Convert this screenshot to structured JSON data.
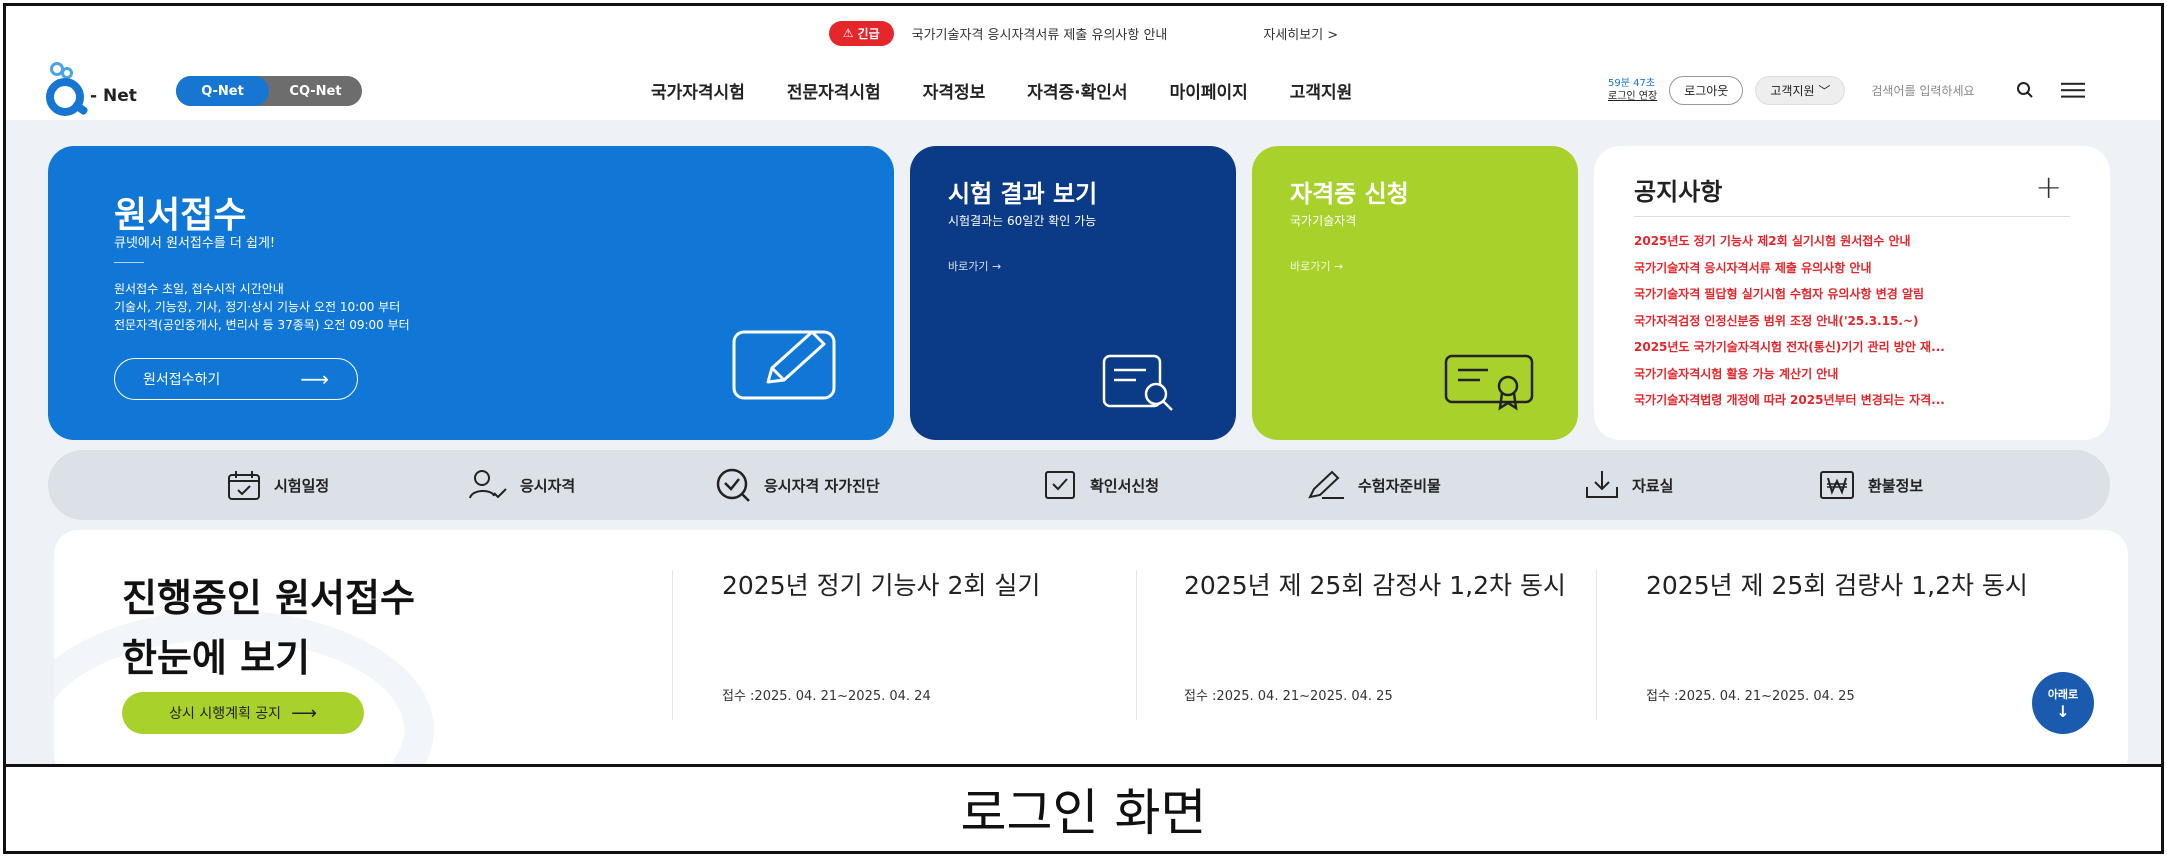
{
  "notice": {
    "badge": "긴급",
    "text": "국가기술자격 응시자격서류 제출 유의사항 안내",
    "more": "자세히보기  >"
  },
  "header": {
    "logo_text": "- Net",
    "toggle": [
      "Q-Net",
      "CQ-Net"
    ],
    "nav": [
      "국가자격시험",
      "전문자격시험",
      "자격정보",
      "자격증·확인서",
      "마이페이지",
      "고객지원"
    ],
    "timer": "59분 47초",
    "extend": "로그인 연장",
    "logout": "로그아웃",
    "support": "고객지원",
    "search_placeholder": "검색어를 입력하세요"
  },
  "cards": {
    "apply": {
      "title": "원서접수",
      "subtitle": "큐넷에서 원서접수를 더 쉽게!",
      "desc": [
        "원서접수 초일, 접수시작 시간안내",
        "기술사, 기능장, 기사, 정기·상시 기능사 오전 10:00 부터",
        "전문자격(공인중개사, 변리사 등 37종목) 오전 09:00 부터"
      ],
      "button": "원서접수하기"
    },
    "result": {
      "title": "시험 결과 보기",
      "subtitle": "시험결과는 60일간 확인 가능",
      "go": "바로가기 →"
    },
    "cert": {
      "title": "자격증 신청",
      "subtitle": "국가기술자격",
      "go": "바로가기 →"
    },
    "notices": {
      "title": "공지사항",
      "items": [
        "2025년도 정기 기능사 제2회 실기시험 원서접수 안내",
        "국가기술자격 응시자격서류 제출 유의사항 안내",
        "국가기술자격 필답형 실기시험 수험자 유의사항 변경 알림",
        "국가자격검정 인정신분증 범위 조정 안내('25.3.15.~)",
        "2025년도 국가기술자격시험 전자(통신)기기 관리 방안 재...",
        "국가기술자격시험 활용 가능 계산기 안내",
        "국가기술자격법령 개정에 따라 2025년부터 변경되는 자격..."
      ]
    }
  },
  "quick": [
    "시험일정",
    "응시자격",
    "응시자격 자가진단",
    "확인서신청",
    "수험자준비물",
    "자료실",
    "환불정보"
  ],
  "ongoing": {
    "title_line1": "진행중인 원서접수",
    "title_line2": "한눈에 보기",
    "button": "상시 시행계획 공지",
    "items": [
      {
        "title": "2025년 정기 기능사 2회 실기",
        "date": "접수 :2025. 04. 21~2025. 04. 24"
      },
      {
        "title": "2025년 제 25회 감정사 1,2차 동시",
        "date": "접수 :2025. 04. 21~2025. 04. 25"
      },
      {
        "title": "2025년 제 25회 검량사 1,2차 동시",
        "date": "접수 :2025. 04. 21~2025. 04. 25"
      }
    ]
  },
  "fab": {
    "label": "아래로",
    "arrow": "↓"
  },
  "caption": "로그인 화면",
  "colors": {
    "primary": "#1077d6",
    "navy": "#0b3a86",
    "lime": "#a9d12b",
    "alert": "#e5262b"
  }
}
